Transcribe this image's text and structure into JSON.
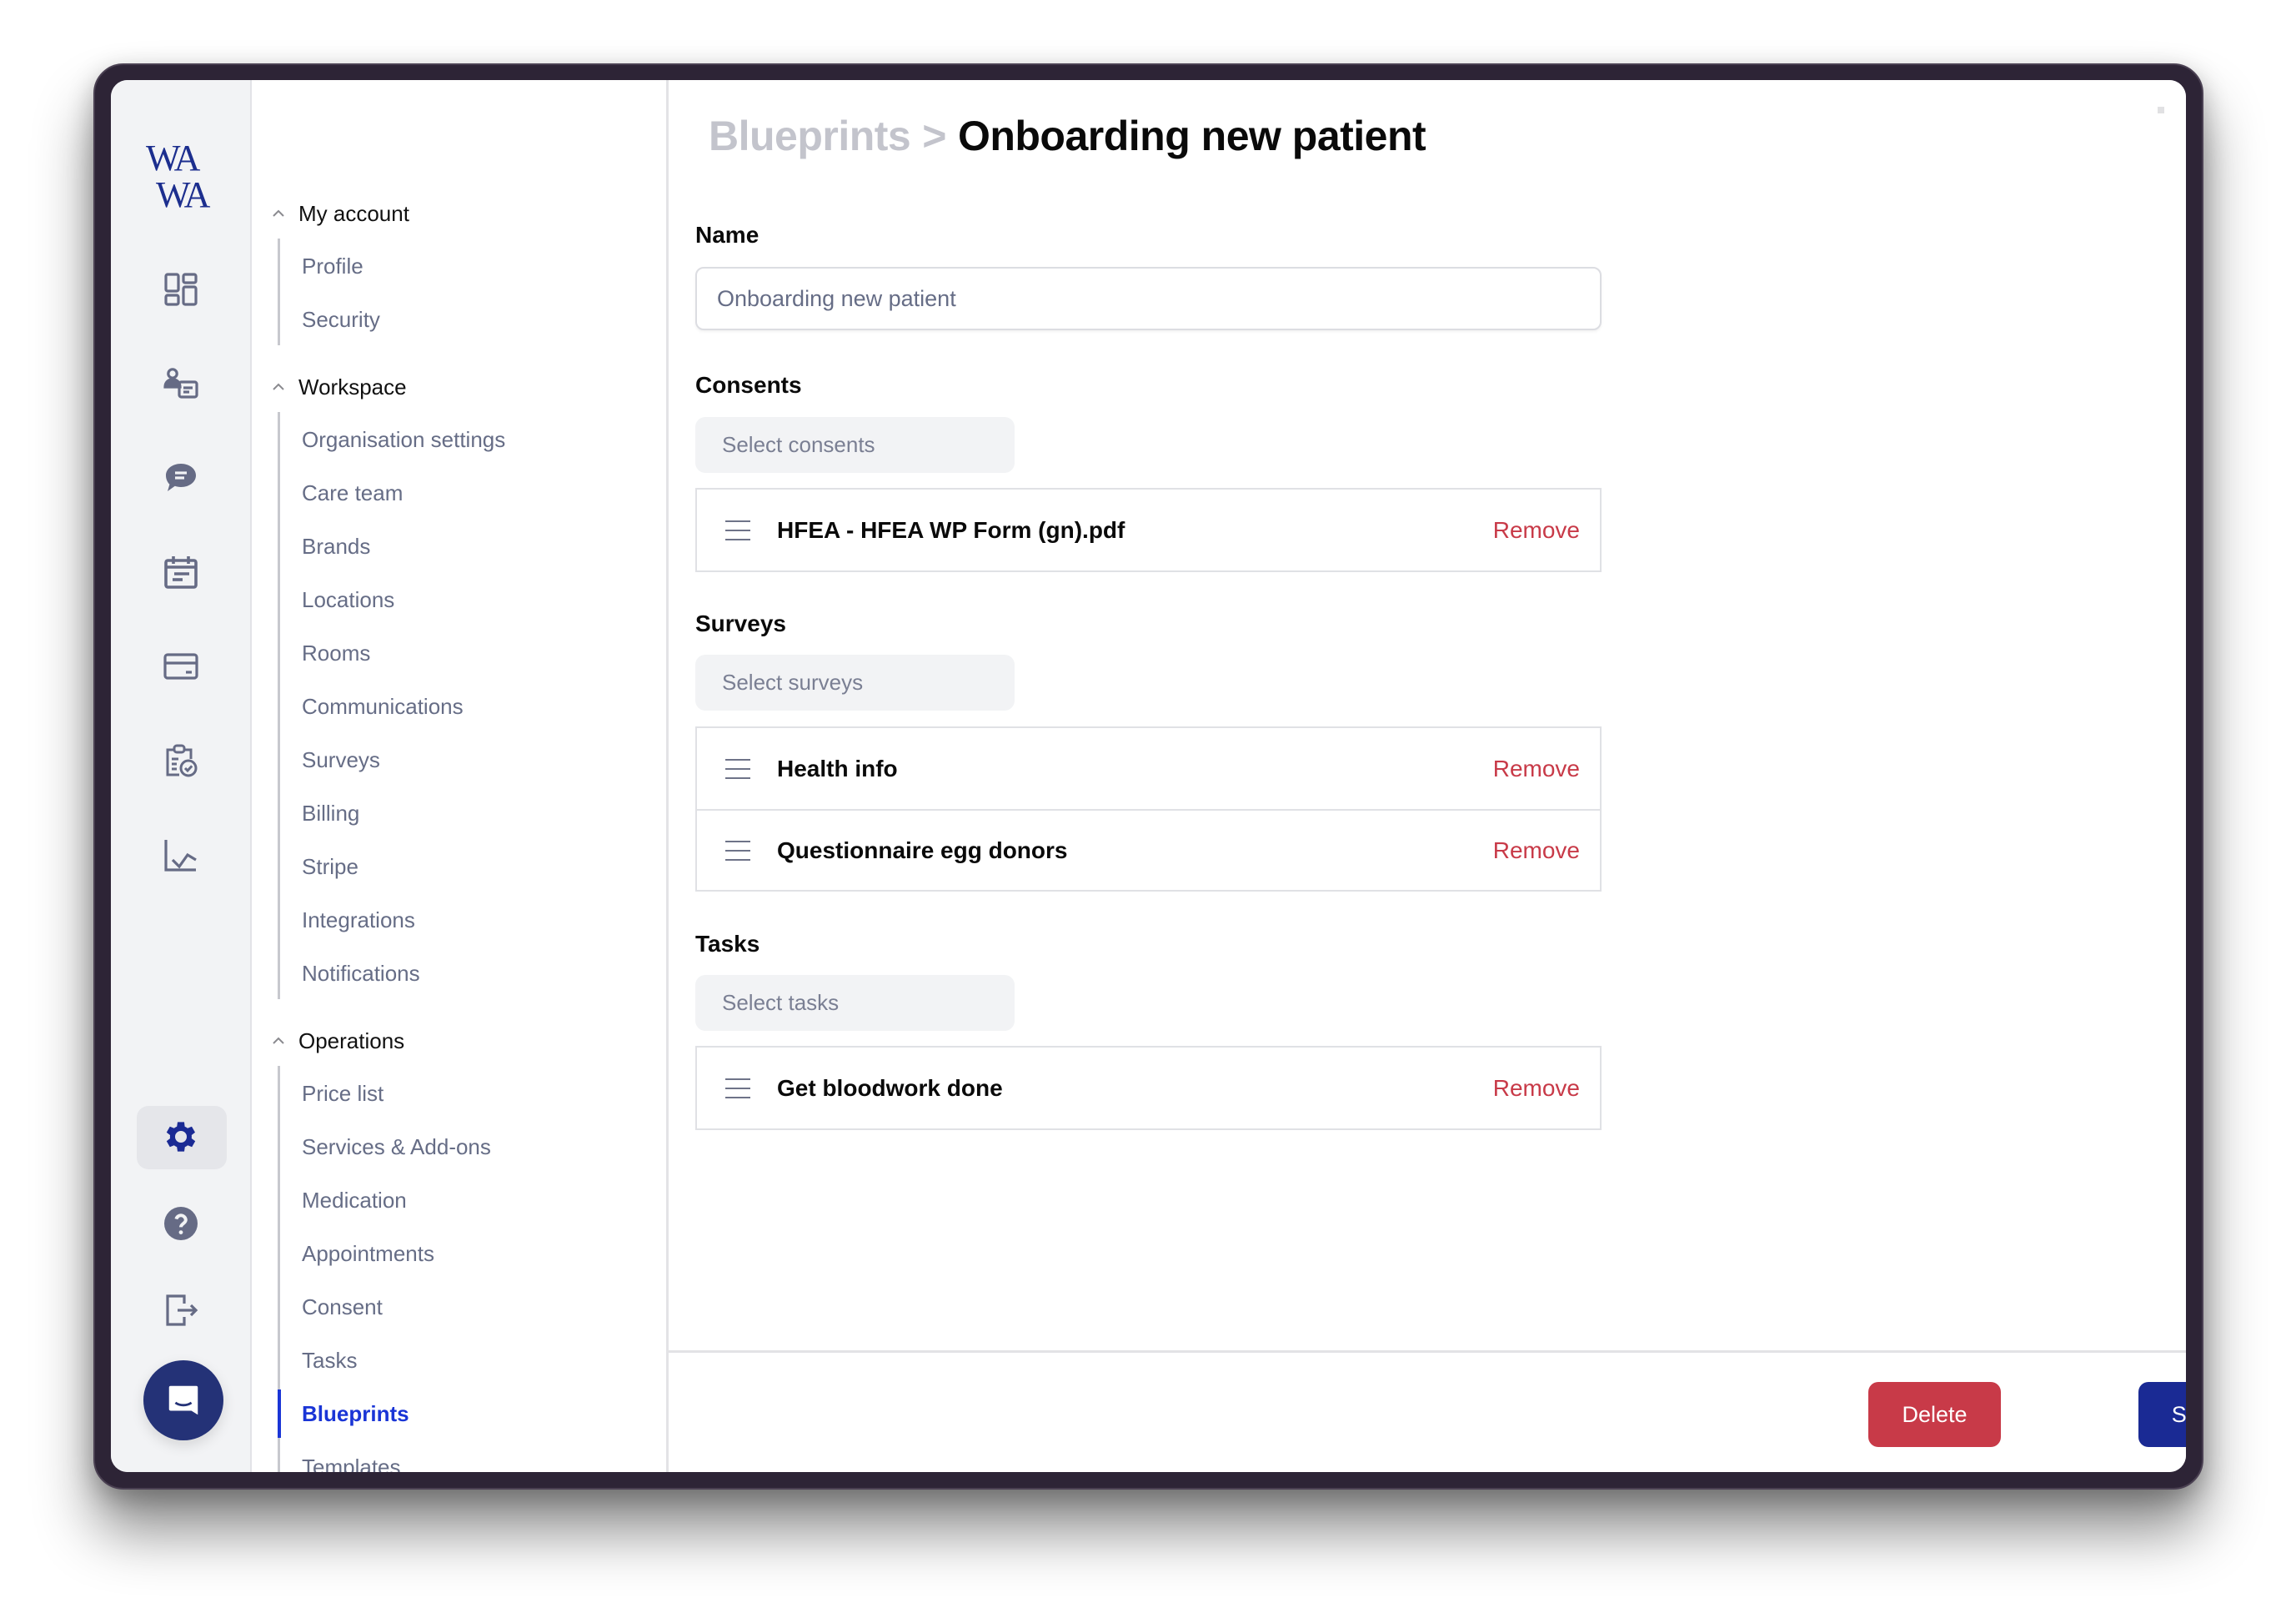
{
  "app": {
    "logo_line1": "WA",
    "logo_line2": "WA"
  },
  "rail": {
    "items": [
      {
        "icon": "dashboard-icon",
        "label": "Dashboard"
      },
      {
        "icon": "patients-icon",
        "label": "Patients"
      },
      {
        "icon": "chat-icon",
        "label": "Messages"
      },
      {
        "icon": "calendar-icon",
        "label": "Calendar"
      },
      {
        "icon": "credit-card-icon",
        "label": "Billing"
      },
      {
        "icon": "clipboard-check-icon",
        "label": "Tasks"
      },
      {
        "icon": "analytics-icon",
        "label": "Analytics"
      }
    ],
    "bottom": [
      {
        "icon": "gear-icon",
        "label": "Settings",
        "active": true
      },
      {
        "icon": "help-icon",
        "label": "Help"
      },
      {
        "icon": "logout-icon",
        "label": "Log out"
      }
    ],
    "chat_widget": "chat-widget-icon"
  },
  "nav": {
    "groups": [
      {
        "label": "My account",
        "items": [
          "Profile",
          "Security"
        ]
      },
      {
        "label": "Workspace",
        "items": [
          "Organisation settings",
          "Care team",
          "Brands",
          "Locations",
          "Rooms",
          "Communications",
          "Surveys",
          "Billing",
          "Stripe",
          "Integrations",
          "Notifications"
        ]
      },
      {
        "label": "Operations",
        "items": [
          "Price list",
          "Services & Add-ons",
          "Medication",
          "Appointments",
          "Consent",
          "Tasks",
          "Blueprints",
          "Templates"
        ]
      }
    ],
    "active_item": "Blueprints"
  },
  "header": {
    "breadcrumb_parent": "Blueprints",
    "separator": ">",
    "title": "Onboarding new patient"
  },
  "form": {
    "name": {
      "label": "Name",
      "value": "Onboarding new patient"
    },
    "consents": {
      "label": "Consents",
      "select_placeholder": "Select consents",
      "items": [
        {
          "name": "HFEA - HFEA WP Form (gn).pdf",
          "action": "Remove"
        }
      ]
    },
    "surveys": {
      "label": "Surveys",
      "select_placeholder": "Select surveys",
      "items": [
        {
          "name": "Health info",
          "action": "Remove"
        },
        {
          "name": "Questionnaire egg donors",
          "action": "Remove"
        }
      ]
    },
    "tasks": {
      "label": "Tasks",
      "select_placeholder": "Select tasks",
      "items": [
        {
          "name": "Get bloodwork done",
          "action": "Remove"
        }
      ]
    }
  },
  "footer": {
    "delete_label": "Delete",
    "save_label": "Save"
  },
  "colors": {
    "brand": "#1c2e8e",
    "active_nav": "#1a35d6",
    "danger": "#c83a48",
    "primary_button": "#1a2a94",
    "frame": "#2d2436"
  }
}
